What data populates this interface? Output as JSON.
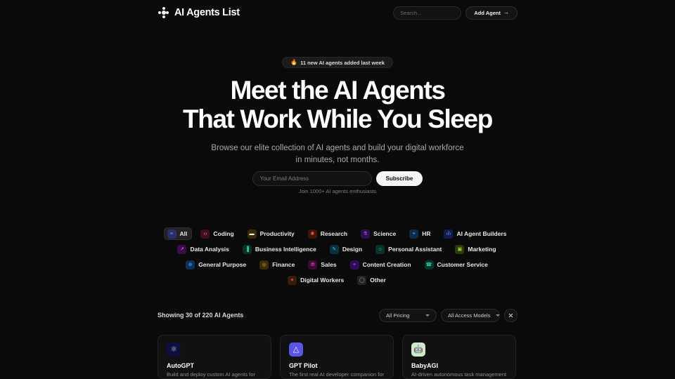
{
  "header": {
    "brand": "AI Agents List",
    "logo_icon": "sparkle-dots-icon",
    "search": {
      "placeholder": "Search...",
      "value": "",
      "icon": "search-icon"
    },
    "add_agent": {
      "label": "Add Agent",
      "arrow": "→"
    }
  },
  "hero": {
    "badge": {
      "emoji": "🔥",
      "text": "11 new AI agents added last week"
    },
    "title_line1": "Meet the AI Agents",
    "title_line2": "That Work While You Sleep",
    "subtitle_line1": "Browse our elite collection of AI agents and build your digital workforce",
    "subtitle_line2": "in minutes, not months.",
    "email": {
      "placeholder": "Your Email Address",
      "value": ""
    },
    "subscribe_label": "Subscribe",
    "join_note": "Join 1000+ AI agents enthusiasts"
  },
  "categories": [
    {
      "label": "All",
      "icon": "layers-icon",
      "glyph": "≡",
      "bg": "#2a2f6e",
      "fg": "#7f8cf0",
      "active": true
    },
    {
      "label": "Coding",
      "icon": "code-brackets-icon",
      "glyph": "‹›",
      "bg": "#3d0f23",
      "fg": "#ef4f80",
      "active": false
    },
    {
      "label": "Productivity",
      "icon": "briefcase-icon",
      "glyph": "▬",
      "bg": "#3a2a05",
      "fg": "#e0a game",
      "active": false
    },
    {
      "label": "Research",
      "icon": "molecule-icon",
      "glyph": "✺",
      "bg": "#3d1608",
      "fg": "#f2613f",
      "active": false
    },
    {
      "label": "Science",
      "icon": "flask-icon",
      "glyph": "⚗",
      "bg": "#2c1150",
      "fg": "#a855f7",
      "active": false
    },
    {
      "label": "HR",
      "icon": "people-icon",
      "glyph": "⚭",
      "bg": "#0d2c47",
      "fg": "#3da5e8",
      "active": false
    },
    {
      "label": "AI Agent Builders",
      "icon": "code-slash-icon",
      "glyph": "‹/›",
      "bg": "#121c4d",
      "fg": "#5b7cf5",
      "active": false
    },
    {
      "label": "Data Analysis",
      "icon": "chart-line-icon",
      "glyph": "↗",
      "bg": "#3a0d4a",
      "fg": "#d94ff0",
      "active": false
    },
    {
      "label": "Business Intelligence",
      "icon": "bar-chart-icon",
      "glyph": "▐",
      "bg": "#07332a",
      "fg": "#2fd7a0",
      "active": false
    },
    {
      "label": "Design",
      "icon": "pen-nib-icon",
      "glyph": "✎",
      "bg": "#0b3040",
      "fg": "#36c2e0",
      "active": false
    },
    {
      "label": "Personal Assistant",
      "icon": "user-icon",
      "glyph": "☺",
      "bg": "#08332b",
      "fg": "#2ed69c",
      "active": false
    },
    {
      "label": "Marketing",
      "icon": "megaphone-icon",
      "glyph": "▣",
      "bg": "#2b3a07",
      "fg": "#a3d130",
      "active": false
    },
    {
      "label": "General Purpose",
      "icon": "globe-icon",
      "glyph": "⊕",
      "bg": "#0d2f58",
      "fg": "#3b8ef0",
      "active": false
    },
    {
      "label": "Finance",
      "icon": "coins-icon",
      "glyph": "◎",
      "bg": "#3a2c05",
      "fg": "#d8aa22",
      "active": false
    },
    {
      "label": "Sales",
      "icon": "cart-icon",
      "glyph": "⛃",
      "bg": "#3d0a33",
      "fg": "#e23bb0",
      "active": false
    },
    {
      "label": "Content Creation",
      "icon": "wand-icon",
      "glyph": "✦",
      "bg": "#2b0f57",
      "fg": "#9333ea",
      "active": false
    },
    {
      "label": "Customer Service",
      "icon": "headset-icon",
      "glyph": "☎",
      "bg": "#07332c",
      "fg": "#25d2a2",
      "active": false
    },
    {
      "label": "Digital Workers",
      "icon": "team-icon",
      "glyph": "⚭",
      "bg": "#3d1b0b",
      "fg": "#e8713a",
      "active": false
    },
    {
      "label": "Other",
      "icon": "chat-bubble-icon",
      "glyph": "◯",
      "bg": "#242424",
      "fg": "#9e9e9e",
      "active": false
    }
  ],
  "results": {
    "count_text": "Showing 30 of 220 AI Agents",
    "pricing_filter": "All Pricing",
    "access_filter": "All Access Models",
    "clear_icon": "close-icon"
  },
  "cards": [
    {
      "name": "AutoGPT",
      "description": "Build and deploy custom AI agents for",
      "logo_icon": "autogpt-logo-icon",
      "logo_glyph": "⚛",
      "logo_bg": "#0e0f3d",
      "logo_fg": "#c9cdf5"
    },
    {
      "name": "GPT Pilot",
      "description": "The first real AI developer companion for",
      "logo_icon": "gptpilot-logo-icon",
      "logo_glyph": "△",
      "logo_bg": "#5b54e8",
      "logo_fg": "#ffffff"
    },
    {
      "name": "BabyAGI",
      "description": "AI-driven autonomous task management",
      "logo_icon": "babyagi-logo-icon",
      "logo_glyph": "🤖",
      "logo_bg": "#cfeacb",
      "logo_fg": "#2b4a2a"
    }
  ]
}
